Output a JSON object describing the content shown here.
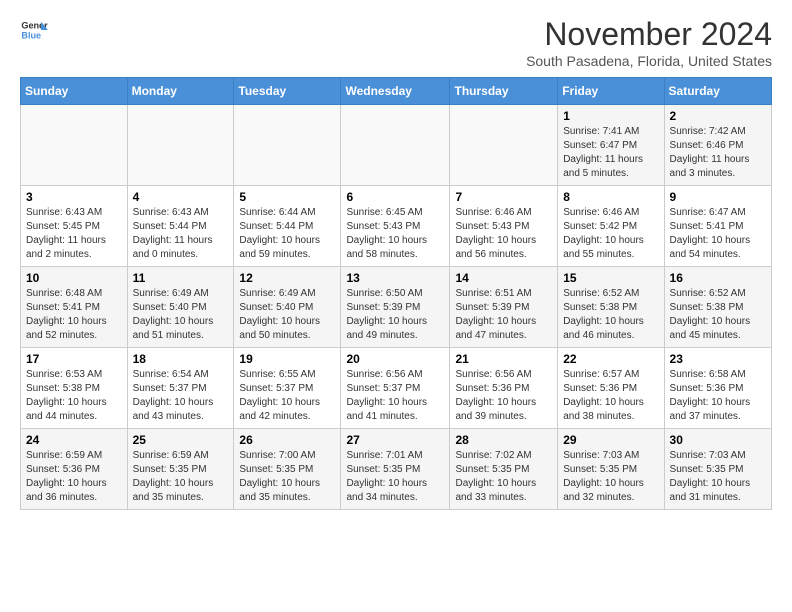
{
  "logo": {
    "line1": "General",
    "line2": "Blue"
  },
  "title": "November 2024",
  "subtitle": "South Pasadena, Florida, United States",
  "days_of_week": [
    "Sunday",
    "Monday",
    "Tuesday",
    "Wednesday",
    "Thursday",
    "Friday",
    "Saturday"
  ],
  "weeks": [
    [
      {
        "day": "",
        "info": ""
      },
      {
        "day": "",
        "info": ""
      },
      {
        "day": "",
        "info": ""
      },
      {
        "day": "",
        "info": ""
      },
      {
        "day": "",
        "info": ""
      },
      {
        "day": "1",
        "info": "Sunrise: 7:41 AM\nSunset: 6:47 PM\nDaylight: 11 hours and 5 minutes."
      },
      {
        "day": "2",
        "info": "Sunrise: 7:42 AM\nSunset: 6:46 PM\nDaylight: 11 hours and 3 minutes."
      }
    ],
    [
      {
        "day": "3",
        "info": "Sunrise: 6:43 AM\nSunset: 5:45 PM\nDaylight: 11 hours and 2 minutes."
      },
      {
        "day": "4",
        "info": "Sunrise: 6:43 AM\nSunset: 5:44 PM\nDaylight: 11 hours and 0 minutes."
      },
      {
        "day": "5",
        "info": "Sunrise: 6:44 AM\nSunset: 5:44 PM\nDaylight: 10 hours and 59 minutes."
      },
      {
        "day": "6",
        "info": "Sunrise: 6:45 AM\nSunset: 5:43 PM\nDaylight: 10 hours and 58 minutes."
      },
      {
        "day": "7",
        "info": "Sunrise: 6:46 AM\nSunset: 5:43 PM\nDaylight: 10 hours and 56 minutes."
      },
      {
        "day": "8",
        "info": "Sunrise: 6:46 AM\nSunset: 5:42 PM\nDaylight: 10 hours and 55 minutes."
      },
      {
        "day": "9",
        "info": "Sunrise: 6:47 AM\nSunset: 5:41 PM\nDaylight: 10 hours and 54 minutes."
      }
    ],
    [
      {
        "day": "10",
        "info": "Sunrise: 6:48 AM\nSunset: 5:41 PM\nDaylight: 10 hours and 52 minutes."
      },
      {
        "day": "11",
        "info": "Sunrise: 6:49 AM\nSunset: 5:40 PM\nDaylight: 10 hours and 51 minutes."
      },
      {
        "day": "12",
        "info": "Sunrise: 6:49 AM\nSunset: 5:40 PM\nDaylight: 10 hours and 50 minutes."
      },
      {
        "day": "13",
        "info": "Sunrise: 6:50 AM\nSunset: 5:39 PM\nDaylight: 10 hours and 49 minutes."
      },
      {
        "day": "14",
        "info": "Sunrise: 6:51 AM\nSunset: 5:39 PM\nDaylight: 10 hours and 47 minutes."
      },
      {
        "day": "15",
        "info": "Sunrise: 6:52 AM\nSunset: 5:38 PM\nDaylight: 10 hours and 46 minutes."
      },
      {
        "day": "16",
        "info": "Sunrise: 6:52 AM\nSunset: 5:38 PM\nDaylight: 10 hours and 45 minutes."
      }
    ],
    [
      {
        "day": "17",
        "info": "Sunrise: 6:53 AM\nSunset: 5:38 PM\nDaylight: 10 hours and 44 minutes."
      },
      {
        "day": "18",
        "info": "Sunrise: 6:54 AM\nSunset: 5:37 PM\nDaylight: 10 hours and 43 minutes."
      },
      {
        "day": "19",
        "info": "Sunrise: 6:55 AM\nSunset: 5:37 PM\nDaylight: 10 hours and 42 minutes."
      },
      {
        "day": "20",
        "info": "Sunrise: 6:56 AM\nSunset: 5:37 PM\nDaylight: 10 hours and 41 minutes."
      },
      {
        "day": "21",
        "info": "Sunrise: 6:56 AM\nSunset: 5:36 PM\nDaylight: 10 hours and 39 minutes."
      },
      {
        "day": "22",
        "info": "Sunrise: 6:57 AM\nSunset: 5:36 PM\nDaylight: 10 hours and 38 minutes."
      },
      {
        "day": "23",
        "info": "Sunrise: 6:58 AM\nSunset: 5:36 PM\nDaylight: 10 hours and 37 minutes."
      }
    ],
    [
      {
        "day": "24",
        "info": "Sunrise: 6:59 AM\nSunset: 5:36 PM\nDaylight: 10 hours and 36 minutes."
      },
      {
        "day": "25",
        "info": "Sunrise: 6:59 AM\nSunset: 5:35 PM\nDaylight: 10 hours and 35 minutes."
      },
      {
        "day": "26",
        "info": "Sunrise: 7:00 AM\nSunset: 5:35 PM\nDaylight: 10 hours and 35 minutes."
      },
      {
        "day": "27",
        "info": "Sunrise: 7:01 AM\nSunset: 5:35 PM\nDaylight: 10 hours and 34 minutes."
      },
      {
        "day": "28",
        "info": "Sunrise: 7:02 AM\nSunset: 5:35 PM\nDaylight: 10 hours and 33 minutes."
      },
      {
        "day": "29",
        "info": "Sunrise: 7:03 AM\nSunset: 5:35 PM\nDaylight: 10 hours and 32 minutes."
      },
      {
        "day": "30",
        "info": "Sunrise: 7:03 AM\nSunset: 5:35 PM\nDaylight: 10 hours and 31 minutes."
      }
    ]
  ]
}
